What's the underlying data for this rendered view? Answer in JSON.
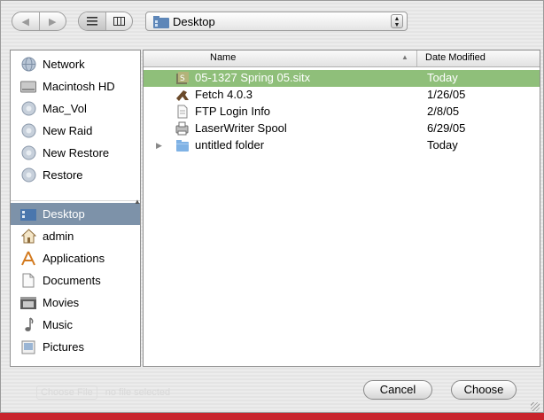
{
  "toolbar": {
    "back_icon": "back-arrow-icon",
    "forward_icon": "forward-arrow-icon",
    "list_view_icon": "list-view-icon",
    "column_view_icon": "column-view-icon",
    "location": "Desktop"
  },
  "sidebar": {
    "devices": [
      {
        "label": "Network",
        "icon": "network-globe-icon"
      },
      {
        "label": "Macintosh HD",
        "icon": "hard-drive-icon"
      },
      {
        "label": "Mac_Vol",
        "icon": "network-volume-icon"
      },
      {
        "label": "New Raid",
        "icon": "network-volume-icon"
      },
      {
        "label": "New Restore",
        "icon": "network-volume-icon"
      },
      {
        "label": "Restore",
        "icon": "network-volume-icon"
      }
    ],
    "places": [
      {
        "label": "Desktop",
        "icon": "desktop-icon",
        "selected": true
      },
      {
        "label": "admin",
        "icon": "home-icon"
      },
      {
        "label": "Applications",
        "icon": "applications-icon"
      },
      {
        "label": "Documents",
        "icon": "documents-icon"
      },
      {
        "label": "Movies",
        "icon": "movies-icon"
      },
      {
        "label": "Music",
        "icon": "music-icon"
      },
      {
        "label": "Pictures",
        "icon": "pictures-icon"
      }
    ]
  },
  "files": {
    "columns": {
      "name": "Name",
      "date": "Date Modified"
    },
    "rows": [
      {
        "name": "05-1327 Spring 05.sitx",
        "date": "Today",
        "icon": "stuffit-archive-icon",
        "selected": true
      },
      {
        "name": "Fetch 4.0.3",
        "date": "1/26/05",
        "icon": "fetch-app-icon"
      },
      {
        "name": "FTP Login Info",
        "date": "2/8/05",
        "icon": "document-icon"
      },
      {
        "name": "LaserWriter Spool",
        "date": "6/29/05",
        "icon": "printer-spool-icon"
      },
      {
        "name": "untitled folder",
        "date": "Today",
        "icon": "folder-icon",
        "expandable": true
      }
    ]
  },
  "background_form": {
    "choose_file": "Choose File",
    "no_file": "no file selected"
  },
  "buttons": {
    "cancel": "Cancel",
    "choose": "Choose"
  },
  "colors": {
    "selection_row": "#8fbf7a",
    "sidebar_selection": "#7d92a9",
    "folder_blue": "#7fb2e5",
    "bottom_bar": "#c8232c"
  }
}
